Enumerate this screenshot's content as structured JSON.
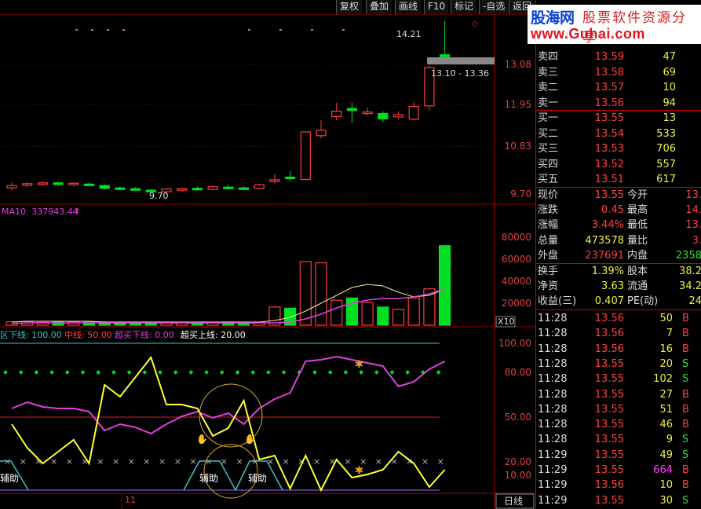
{
  "toolbar": {
    "buttons": [
      "复权",
      "叠加",
      "画线",
      "F10",
      "标记",
      "-自选",
      "返回"
    ]
  },
  "logo": {
    "brand": "股海网",
    "tagline": "股票软件资源分享",
    "url": "www.Guhai.com"
  },
  "kline": {
    "prices": [
      "13.08",
      "11.95",
      "10.83",
      "9.70"
    ],
    "high_label": "14.21",
    "low_label": "9.70",
    "range_label": "13.10 - 13.36",
    "candles": [
      {
        "o": 9.86,
        "c": 9.92,
        "h": 10.0,
        "l": 9.8
      },
      {
        "o": 9.93,
        "c": 9.97,
        "h": 10.02,
        "l": 9.88
      },
      {
        "o": 9.95,
        "c": 9.99,
        "h": 10.04,
        "l": 9.9
      },
      {
        "o": 9.99,
        "c": 9.96,
        "h": 10.02,
        "l": 9.92
      },
      {
        "o": 9.94,
        "c": 9.98,
        "h": 10.01,
        "l": 9.9
      },
      {
        "o": 9.96,
        "c": 9.94,
        "h": 9.99,
        "l": 9.9
      },
      {
        "o": 9.92,
        "c": 9.85,
        "h": 9.95,
        "l": 9.82
      },
      {
        "o": 9.86,
        "c": 9.83,
        "h": 9.9,
        "l": 9.8
      },
      {
        "o": 9.84,
        "c": 9.81,
        "h": 9.88,
        "l": 9.78
      },
      {
        "o": 9.8,
        "c": 9.76,
        "h": 9.82,
        "l": 9.72
      },
      {
        "o": 9.76,
        "c": 9.83,
        "h": 9.85,
        "l": 9.7
      },
      {
        "o": 9.81,
        "c": 9.84,
        "h": 9.86,
        "l": 9.77
      },
      {
        "o": 9.85,
        "c": 9.82,
        "h": 9.9,
        "l": 9.79
      },
      {
        "o": 9.82,
        "c": 9.89,
        "h": 9.92,
        "l": 9.8
      },
      {
        "o": 9.88,
        "c": 9.85,
        "h": 9.94,
        "l": 9.83
      },
      {
        "o": 9.86,
        "c": 9.84,
        "h": 9.9,
        "l": 9.81
      },
      {
        "o": 9.85,
        "c": 9.94,
        "h": 9.97,
        "l": 9.83
      },
      {
        "o": 10.05,
        "c": 10.07,
        "h": 10.22,
        "l": 9.98
      },
      {
        "o": 10.14,
        "c": 10.1,
        "h": 10.3,
        "l": 10.05
      },
      {
        "o": 10.08,
        "c": 11.32,
        "h": 11.34,
        "l": 10.06
      },
      {
        "o": 11.22,
        "c": 11.36,
        "h": 11.62,
        "l": 11.15
      },
      {
        "o": 11.72,
        "c": 11.86,
        "h": 12.08,
        "l": 11.62
      },
      {
        "o": 11.93,
        "c": 11.88,
        "h": 12.08,
        "l": 11.56
      },
      {
        "o": 11.8,
        "c": 11.84,
        "h": 11.95,
        "l": 11.76
      },
      {
        "o": 11.8,
        "c": 11.66,
        "h": 11.86,
        "l": 11.56
      },
      {
        "o": 11.71,
        "c": 11.77,
        "h": 11.86,
        "l": 11.66
      },
      {
        "o": 11.65,
        "c": 11.98,
        "h": 12.1,
        "l": 11.62
      },
      {
        "o": 12.0,
        "c": 13.0,
        "h": 13.05,
        "l": 11.88
      },
      {
        "o": 13.33,
        "c": 13.28,
        "h": 14.21,
        "l": 13.1
      }
    ]
  },
  "volume": {
    "ma_label": "MA10: 337943.44",
    "axis": [
      "80000",
      "60000",
      "40000",
      "20000"
    ],
    "scale_label": "X10",
    "bars": [
      3000,
      3200,
      2500,
      2800,
      3000,
      2600,
      2400,
      2200,
      2000,
      2100,
      2300,
      2400,
      2000,
      2500,
      2800,
      2600,
      2400,
      16000,
      15000,
      56000,
      55000,
      22000,
      24000,
      20000,
      16000,
      14000,
      24000,
      32000,
      70000
    ],
    "current_bar": 47000
  },
  "indicator": {
    "label_name": "区下线: 100.00",
    "label_mid": "中线: 50.00",
    "label_oversold": "超买下线: 0.00",
    "label_overbought": "超买上线: 20.00",
    "axis": [
      "100.00",
      "80.00",
      "50.00",
      "20.00",
      "10.00"
    ],
    "aux_label_1": "辅助",
    "aux_label_2": "辅助",
    "aux_label_3": "辅助"
  },
  "bottom": {
    "date_label": "11",
    "period_label": "日线"
  },
  "orderbook": {
    "asks": [
      {
        "label": "卖四",
        "price": "13.59",
        "vol": "47"
      },
      {
        "label": "卖三",
        "price": "13.58",
        "vol": "69"
      },
      {
        "label": "卖二",
        "price": "13.57",
        "vol": "10"
      },
      {
        "label": "卖一",
        "price": "13.56",
        "vol": "94"
      }
    ],
    "bids": [
      {
        "label": "买一",
        "price": "13.55",
        "vol": "13"
      },
      {
        "label": "买二",
        "price": "13.54",
        "vol": "533"
      },
      {
        "label": "买三",
        "price": "13.53",
        "vol": "706"
      },
      {
        "label": "买四",
        "price": "13.52",
        "vol": "557"
      },
      {
        "label": "买五",
        "price": "13.51",
        "vol": "617"
      }
    ]
  },
  "stats": [
    {
      "l1": "现价",
      "v1": "13.55",
      "l2": "今开",
      "v2": "13."
    },
    {
      "l1": "涨跌",
      "v1": "0.45",
      "l2": "最高",
      "v2": "14."
    },
    {
      "l1": "涨幅",
      "v1": "3.44%",
      "l2": "最低",
      "v2": "13."
    },
    {
      "l1": "总量",
      "v1": "473578",
      "l2": "量比",
      "v2": "3."
    },
    {
      "l1": "外盘",
      "v1": "237691",
      "l2": "内盘",
      "v2": "2358"
    }
  ],
  "stats2": [
    {
      "l1": "换手",
      "v1": "1.39%",
      "l2": "股本",
      "v2": "38.2"
    },
    {
      "l1": "净资",
      "v1": "3.63",
      "l2": "流通",
      "v2": "34.2"
    },
    {
      "l1": "收益(三)",
      "v1": "0.407",
      "l2": "PE(动)",
      "v2": "24"
    }
  ],
  "ticks": [
    {
      "t": "11:28",
      "p": "13.56",
      "v": "50",
      "s": "B"
    },
    {
      "t": "11:28",
      "p": "13.56",
      "v": "7",
      "s": "B"
    },
    {
      "t": "11:28",
      "p": "13.56",
      "v": "16",
      "s": "B"
    },
    {
      "t": "11:28",
      "p": "13.55",
      "v": "20",
      "s": "S"
    },
    {
      "t": "11:28",
      "p": "13.55",
      "v": "102",
      "s": "S"
    },
    {
      "t": "11:28",
      "p": "13.55",
      "v": "27",
      "s": "B"
    },
    {
      "t": "11:28",
      "p": "13.55",
      "v": "51",
      "s": "B"
    },
    {
      "t": "11:28",
      "p": "13.55",
      "v": "46",
      "s": "B"
    },
    {
      "t": "11:28",
      "p": "13.55",
      "v": "9",
      "s": "S"
    },
    {
      "t": "11:29",
      "p": "13.55",
      "v": "49",
      "s": "S"
    },
    {
      "t": "11:29",
      "p": "13.55",
      "v": "664",
      "s": "B"
    },
    {
      "t": "11:29",
      "p": "13.56",
      "v": "10",
      "s": "B"
    },
    {
      "t": "11:29",
      "p": "13.55",
      "v": "30",
      "s": "S"
    }
  ]
}
